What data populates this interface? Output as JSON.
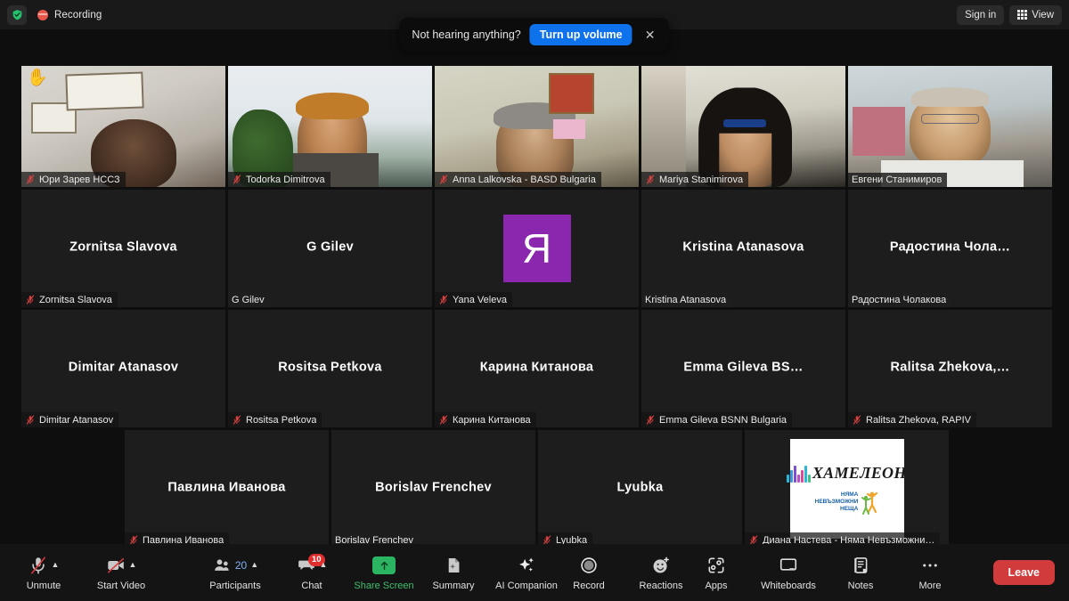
{
  "topbar": {
    "shield_icon": "shield-check-icon",
    "recording_icon": "recording-indicator-icon",
    "recording_label": "Recording",
    "sign_in_label": "Sign in",
    "view_icon": "grid-view-icon",
    "view_label": "View"
  },
  "toast": {
    "message": "Not hearing anything?",
    "cta_label": "Turn up volume",
    "close_label": "✕"
  },
  "colors": {
    "accent_blue": "#0e72ed",
    "active_speaker_border": "#d2e755",
    "avatar_purple": "#8b27af",
    "leave_red": "#d13b3b",
    "share_green": "#2bb563",
    "badge_red": "#e02d2d",
    "recording_red": "#e8564a",
    "shield_green": "#25c16f"
  },
  "gallery": {
    "rows": [
      {
        "tiles": [
          {
            "display_name": "Юри Зарев НССЗ",
            "kind": "video",
            "muted": true,
            "speaking": false,
            "hand_raised": true,
            "hand_emoji": "✋"
          },
          {
            "display_name": "Todorka Dimitrova",
            "kind": "video",
            "muted": true,
            "speaking": false,
            "hand_raised": false
          },
          {
            "display_name": "Anna Lalkovska - BASD Bulgaria",
            "kind": "video",
            "muted": true,
            "speaking": false,
            "hand_raised": false
          },
          {
            "display_name": "Mariya Stanimirova",
            "kind": "video",
            "muted": true,
            "speaking": false,
            "hand_raised": false
          },
          {
            "display_name": "Евгени Станимиров",
            "kind": "video",
            "muted": false,
            "speaking": true,
            "hand_raised": false
          }
        ]
      },
      {
        "tiles": [
          {
            "display_name": "Zornitsa Slavova",
            "big_name": "Zornitsa Slavova",
            "kind": "name",
            "muted": true,
            "speaking": false
          },
          {
            "display_name": "G Gilev",
            "big_name": "G Gilev",
            "kind": "name",
            "muted": false,
            "speaking": false
          },
          {
            "display_name": "Yana Veleva",
            "kind": "avatar",
            "avatar_letter": "Я",
            "muted": true,
            "speaking": false
          },
          {
            "display_name": "Kristina Atanasova",
            "big_name": "Kristina Atanasova",
            "kind": "name",
            "muted": false,
            "speaking": false
          },
          {
            "display_name": "Радостина Чолакова",
            "big_name": "Радостина  Чола…",
            "kind": "name",
            "muted": false,
            "speaking": false
          }
        ]
      },
      {
        "tiles": [
          {
            "display_name": "Dimitar Atanasov",
            "big_name": "Dimitar Atanasov",
            "kind": "name",
            "muted": true,
            "speaking": false
          },
          {
            "display_name": "Rositsa Petkova",
            "big_name": "Rositsa Petkova",
            "kind": "name",
            "muted": true,
            "speaking": false
          },
          {
            "display_name": "Карина Китанова",
            "big_name": "Карина Китанова",
            "kind": "name",
            "muted": true,
            "speaking": false
          },
          {
            "display_name": "Emma Gileva BSNN Bulgaria",
            "big_name": "Emma Gileva  BS…",
            "kind": "name",
            "muted": true,
            "speaking": false
          },
          {
            "display_name": "Ralitsa Zhekova, RAPIV",
            "big_name": "Ralitsa  Zhekova,…",
            "kind": "name",
            "muted": true,
            "speaking": false
          }
        ]
      },
      {
        "tiles": [
          {
            "display_name": "Павлина Иванова",
            "big_name": "Павлина Иванова",
            "kind": "name",
            "muted": true,
            "speaking": false
          },
          {
            "display_name": "Borislav Frenchev",
            "big_name": "Borislav Frenchev",
            "kind": "name",
            "muted": false,
            "speaking": false
          },
          {
            "display_name": "Lyubka",
            "big_name": "Lyubka",
            "kind": "name",
            "muted": true,
            "speaking": false
          },
          {
            "display_name": "Диана Настева -  Няма Невъзможни…",
            "kind": "logo",
            "muted": true,
            "speaking": false,
            "logo_word": "ХАМЕЛЕОН",
            "logo_sub_line1": "НЯМА",
            "logo_sub_line2": "НЕВЪЗМОЖНИ",
            "logo_sub_line3": "НЕЩА"
          }
        ]
      }
    ]
  },
  "toolbar": {
    "items": [
      {
        "id": "audio",
        "label": "Unmute",
        "icon": "microphone-muted-icon",
        "caret": true
      },
      {
        "id": "video",
        "label": "Start Video",
        "icon": "camera-off-icon",
        "caret": true
      },
      {
        "id": "participants",
        "label": "Participants",
        "icon": "participants-icon",
        "caret": true,
        "count": "20"
      },
      {
        "id": "chat",
        "label": "Chat",
        "icon": "chat-bubble-icon",
        "caret": true,
        "badge": "10"
      },
      {
        "id": "share",
        "label": "Share Screen",
        "icon": "share-screen-icon",
        "caret": false
      },
      {
        "id": "summary",
        "label": "Summary",
        "icon": "summary-doc-icon",
        "caret": false
      },
      {
        "id": "ai",
        "label": "AI Companion",
        "icon": "ai-sparkle-icon",
        "caret": false
      },
      {
        "id": "record",
        "label": "Record",
        "icon": "record-circle-icon",
        "caret": false
      },
      {
        "id": "reactions",
        "label": "Reactions",
        "icon": "reactions-smiley-icon",
        "caret": false
      },
      {
        "id": "apps",
        "label": "Apps",
        "icon": "apps-icon",
        "caret": false
      },
      {
        "id": "whiteboards",
        "label": "Whiteboards",
        "icon": "whiteboard-icon",
        "caret": false
      },
      {
        "id": "notes",
        "label": "Notes",
        "icon": "notes-icon",
        "caret": false
      },
      {
        "id": "more",
        "label": "More",
        "icon": "more-ellipsis-icon",
        "caret": false
      }
    ],
    "leave_label": "Leave"
  }
}
